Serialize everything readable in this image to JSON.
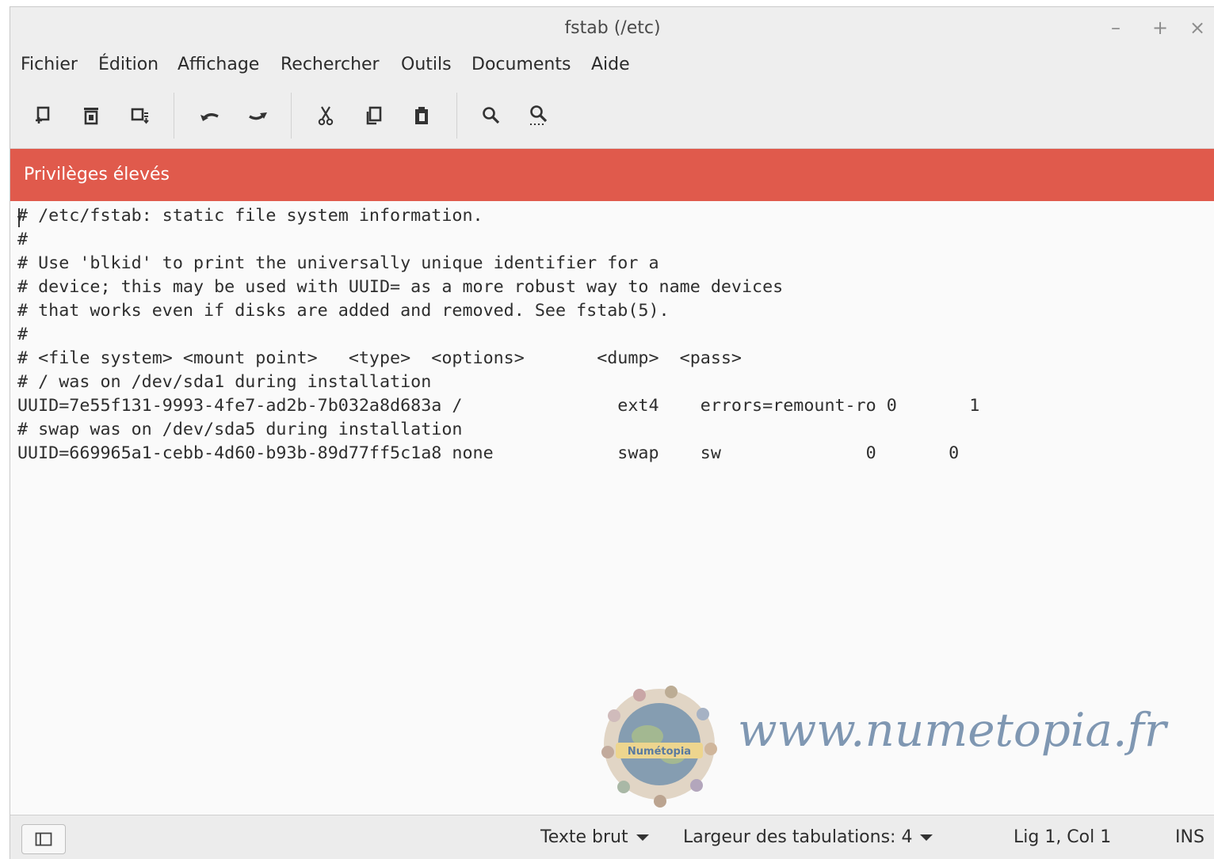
{
  "window": {
    "title": "fstab (/etc)",
    "controls": {
      "minimize": "–",
      "maximize": "+",
      "close": "×"
    }
  },
  "menubar": {
    "items": [
      "Fichier",
      "Édition",
      "Affichage",
      "Rechercher",
      "Outils",
      "Documents",
      "Aide"
    ]
  },
  "toolbar": {
    "icons": [
      "new-document-icon",
      "close-document-icon",
      "save-icon",
      "undo-icon",
      "redo-icon",
      "cut-icon",
      "copy-icon",
      "paste-icon",
      "search-icon",
      "search-replace-icon"
    ]
  },
  "banner": {
    "text": "Privilèges élevés",
    "color": "#e05a4c"
  },
  "editor": {
    "lines": [
      "# /etc/fstab: static file system information.",
      "#",
      "# Use 'blkid' to print the universally unique identifier for a",
      "# device; this may be used with UUID= as a more robust way to name devices",
      "# that works even if disks are added and removed. See fstab(5).",
      "#",
      "# <file system> <mount point>   <type>  <options>       <dump>  <pass>",
      "# / was on /dev/sda1 during installation",
      "UUID=7e55f131-9993-4fe7-ad2b-7b032a8d683a /               ext4    errors=remount-ro 0       1",
      "# swap was on /dev/sda5 during installation",
      "UUID=669965a1-cebb-4d60-b93b-89d77ff5c1a8 none            swap    sw              0       0"
    ]
  },
  "watermark": {
    "logo_text": "Numétopia",
    "text": "www.numetopia.fr"
  },
  "statusbar": {
    "language": "Texte brut",
    "tab_width": "Largeur des tabulations: 4",
    "position": "Lig 1, Col 1",
    "mode": "INS"
  }
}
